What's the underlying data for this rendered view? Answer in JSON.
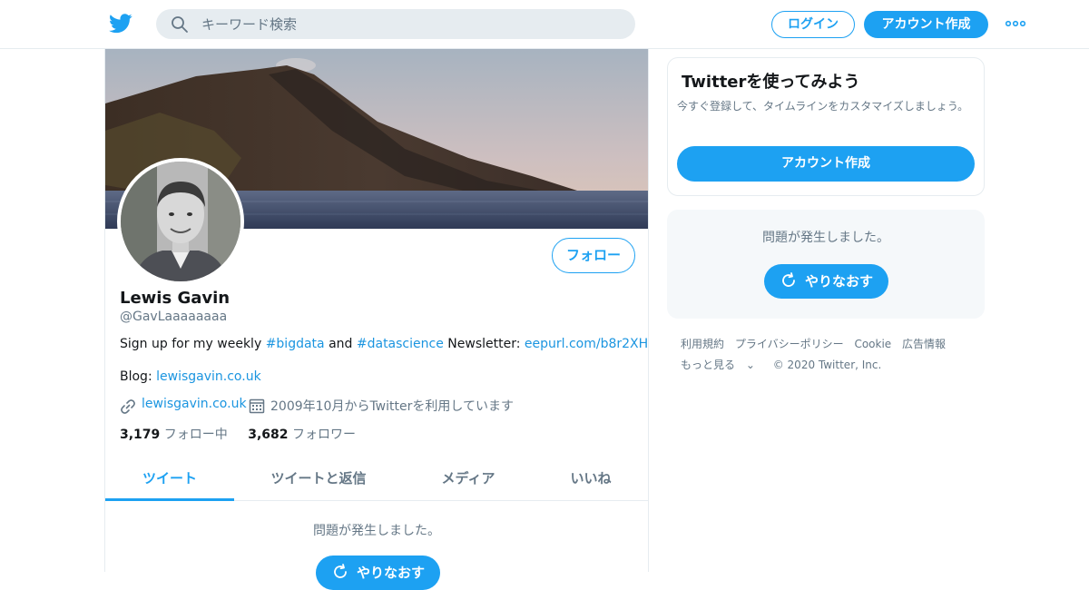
{
  "header": {
    "search_placeholder": "キーワード検索",
    "login_label": "ログイン",
    "signup_label": "アカウント作成"
  },
  "profile": {
    "name": "Lewis Gavin",
    "handle": "@GavLaaaaaaaa",
    "bio": {
      "prefix": "Sign up for my weekly ",
      "tag1": "#bigdata",
      "and": " and ",
      "tag2": "#datascience",
      "newsletter": " Newsletter: ",
      "newsletter_link": "eepurl.com/b8r2XH"
    },
    "blog": {
      "prefix": "Blog: ",
      "link": "lewisgavin.co.uk"
    },
    "url": "lewisgavin.co.uk",
    "joined": "2009年10月からTwitterを利用しています",
    "following_count": "3,179",
    "following_label": "フォロー中",
    "followers_count": "3,682",
    "followers_label": "フォロワー",
    "follow_button": "フォロー"
  },
  "tabs": [
    {
      "label": "ツイート",
      "active": true
    },
    {
      "label": "ツイートと返信",
      "active": false
    },
    {
      "label": "メディア",
      "active": false
    },
    {
      "label": "いいね",
      "active": false
    }
  ],
  "timeline": {
    "error": "問題が発生しました。",
    "retry": "やりなおす"
  },
  "signup_card": {
    "title": "Twitterを使ってみよう",
    "subtitle": "今すぐ登録して、タイムラインをカスタマイズしましょう。",
    "button": "アカウント作成"
  },
  "sidebar_error": {
    "message": "問題が発生しました。",
    "retry": "やりなおす"
  },
  "footer": {
    "links": [
      "利用規約",
      "プライバシーポリシー",
      "Cookie",
      "広告情報"
    ],
    "more": "もっと見る",
    "copyright": "© 2020 Twitter, Inc."
  },
  "colors": {
    "accent": "#1da1f2",
    "link": "#1b95e0",
    "muted": "#657786"
  },
  "icons": {
    "logo": "twitter-bird-icon",
    "search": "search-icon",
    "more": "more-dots-icon",
    "link": "link-icon",
    "calendar": "calendar-icon",
    "retry": "refresh-icon"
  }
}
